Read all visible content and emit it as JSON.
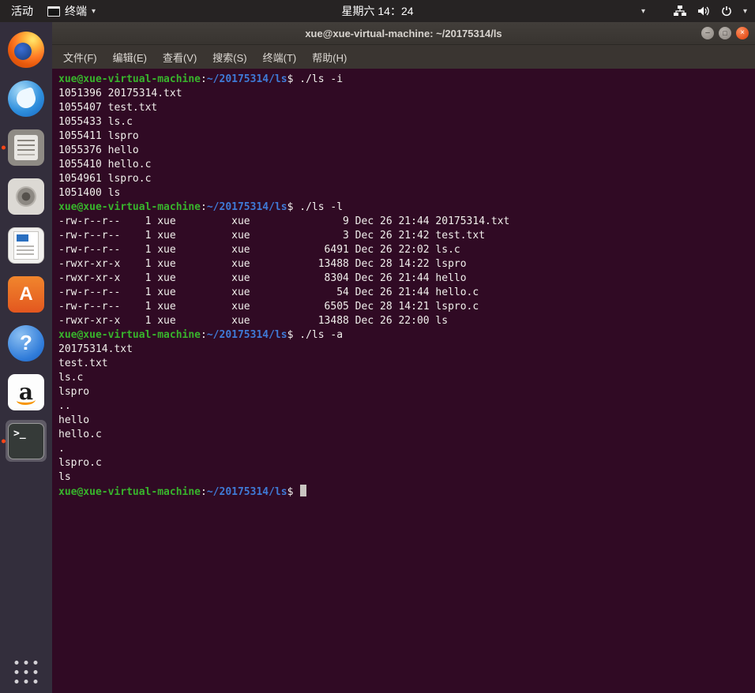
{
  "colors": {
    "accent": "#e95420",
    "terminal_bg": "#300a24",
    "prompt_green": "#38b42c",
    "prompt_blue": "#3f7ad6",
    "terminal_fg": "#f1efec"
  },
  "topbar": {
    "activities": "活动",
    "focused_app": "终端",
    "clock": "星期六 14：24"
  },
  "icons": {
    "chevron_down": "▾",
    "minimize_glyph": "–",
    "maximize_glyph": "□",
    "close_glyph": "×",
    "terminal_glyph": ">_",
    "software_letter": "A",
    "help_glyph": "?",
    "amazon_letter": "a"
  },
  "dock": {
    "items": [
      "firefox",
      "thunderbird",
      "files",
      "rhythmbox",
      "libreoffice-writer",
      "ubuntu-software",
      "help",
      "amazon",
      "terminal"
    ],
    "running_items": [
      "files",
      "terminal"
    ],
    "focused_item": "terminal"
  },
  "window": {
    "title": "xue@xue-virtual-machine: ~/20175314/ls",
    "menu": [
      "文件(F)",
      "编辑(E)",
      "查看(V)",
      "搜索(S)",
      "终端(T)",
      "帮助(H)"
    ]
  },
  "terminal": {
    "prompt": {
      "user": "xue@xue-virtual-machine",
      "separator": ":",
      "path": "~/20175314/ls",
      "symbol": "$"
    },
    "blocks": [
      {
        "command": "./ls -i",
        "output": [
          "1051396 20175314.txt",
          "1055407 test.txt",
          "1055433 ls.c",
          "1055411 lspro",
          "1055376 hello",
          "1055410 hello.c",
          "1054961 lspro.c",
          "1051400 ls"
        ]
      },
      {
        "command": "./ls -l",
        "output": [
          "-rw-r--r--    1 xue         xue               9 Dec 26 21:44 20175314.txt",
          "-rw-r--r--    1 xue         xue               3 Dec 26 21:42 test.txt",
          "-rw-r--r--    1 xue         xue            6491 Dec 26 22:02 ls.c",
          "-rwxr-xr-x    1 xue         xue           13488 Dec 28 14:22 lspro",
          "-rwxr-xr-x    1 xue         xue            8304 Dec 26 21:44 hello",
          "-rw-r--r--    1 xue         xue              54 Dec 26 21:44 hello.c",
          "-rw-r--r--    1 xue         xue            6505 Dec 28 14:21 lspro.c",
          "-rwxr-xr-x    1 xue         xue           13488 Dec 26 22:00 ls"
        ]
      },
      {
        "command": "./ls -a",
        "output": [
          "20175314.txt",
          "test.txt",
          "ls.c",
          "lspro",
          "..",
          "hello",
          "hello.c",
          ".",
          "lspro.c",
          "ls"
        ]
      },
      {
        "command": "",
        "cursor": true,
        "output": []
      }
    ]
  }
}
